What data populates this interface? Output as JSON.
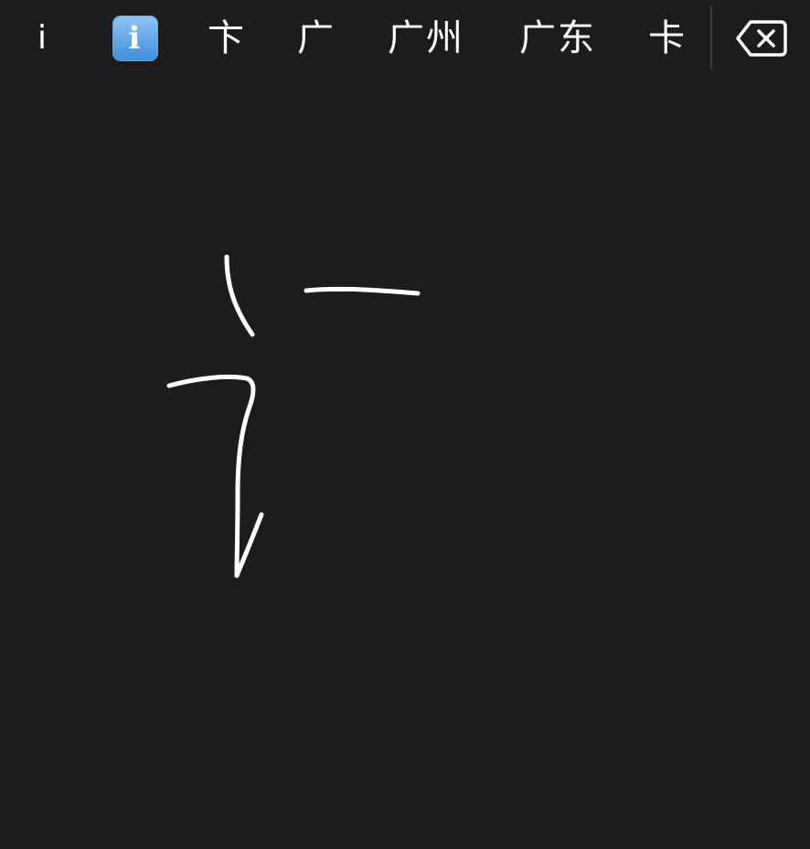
{
  "keyboard": {
    "mode": "handwriting",
    "background_color": "#1c1c1e",
    "ink_color": "#ffffff",
    "candidates": [
      {
        "text": "i",
        "kind": "text"
      },
      {
        "text": "ℹ️",
        "kind": "emoji",
        "icon": "information-emoji-icon",
        "glyph": "i"
      },
      {
        "text": "卞",
        "kind": "text"
      },
      {
        "text": "广",
        "kind": "text"
      },
      {
        "text": "广州",
        "kind": "text"
      },
      {
        "text": "广东",
        "kind": "text"
      },
      {
        "text": "卡",
        "kind": "text"
      }
    ],
    "delete_key": {
      "icon": "backspace-icon"
    },
    "strokes_count": 3
  }
}
